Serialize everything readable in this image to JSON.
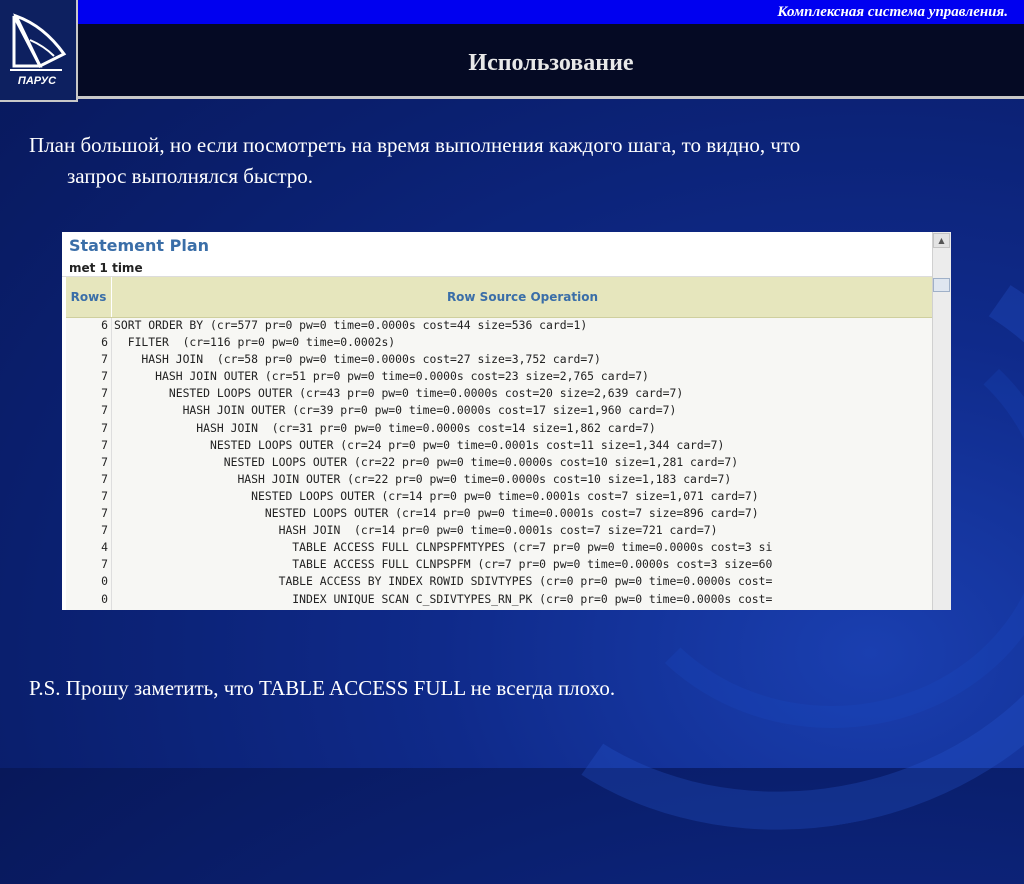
{
  "header": {
    "brand_line": "Комплексная система управления.",
    "title": "Использование",
    "logo_text": "ПАРУС"
  },
  "body": {
    "paragraph_line1": "План большой, но если посмотреть на время выполнения каждого шага, то видно, что",
    "paragraph_line2": "запрос выполнялся быстро.",
    "ps": "P.S. Прошу заметить, что TABLE ACCESS FULL не всегда плохо."
  },
  "plan": {
    "title": "Statement Plan",
    "subtitle": "met 1 time",
    "columns": {
      "rows": "Rows",
      "operation": "Row Source Operation"
    },
    "rows": [
      {
        "count": "6",
        "op": "SORT ORDER BY (cr=577 pr=0 pw=0 time=0.0000s cost=44 size=536 card=1)"
      },
      {
        "count": "6",
        "op": "  FILTER  (cr=116 pr=0 pw=0 time=0.0002s)"
      },
      {
        "count": "7",
        "op": "    HASH JOIN  (cr=58 pr=0 pw=0 time=0.0000s cost=27 size=3,752 card=7)"
      },
      {
        "count": "7",
        "op": "      HASH JOIN OUTER (cr=51 pr=0 pw=0 time=0.0000s cost=23 size=2,765 card=7)"
      },
      {
        "count": "7",
        "op": "        NESTED LOOPS OUTER (cr=43 pr=0 pw=0 time=0.0000s cost=20 size=2,639 card=7)"
      },
      {
        "count": "7",
        "op": "          HASH JOIN OUTER (cr=39 pr=0 pw=0 time=0.0000s cost=17 size=1,960 card=7)"
      },
      {
        "count": "7",
        "op": "            HASH JOIN  (cr=31 pr=0 pw=0 time=0.0000s cost=14 size=1,862 card=7)"
      },
      {
        "count": "7",
        "op": "              NESTED LOOPS OUTER (cr=24 pr=0 pw=0 time=0.0001s cost=11 size=1,344 card=7)"
      },
      {
        "count": "7",
        "op": "                NESTED LOOPS OUTER (cr=22 pr=0 pw=0 time=0.0000s cost=10 size=1,281 card=7)"
      },
      {
        "count": "7",
        "op": "                  HASH JOIN OUTER (cr=22 pr=0 pw=0 time=0.0000s cost=10 size=1,183 card=7)"
      },
      {
        "count": "7",
        "op": "                    NESTED LOOPS OUTER (cr=14 pr=0 pw=0 time=0.0001s cost=7 size=1,071 card=7)"
      },
      {
        "count": "7",
        "op": "                      NESTED LOOPS OUTER (cr=14 pr=0 pw=0 time=0.0001s cost=7 size=896 card=7)"
      },
      {
        "count": "7",
        "op": "                        HASH JOIN  (cr=14 pr=0 pw=0 time=0.0001s cost=7 size=721 card=7)"
      },
      {
        "count": "4",
        "op": "                          TABLE ACCESS FULL CLNPSPFMTYPES (cr=7 pr=0 pw=0 time=0.0000s cost=3 si"
      },
      {
        "count": "7",
        "op": "                          TABLE ACCESS FULL CLNPSPFM (cr=7 pr=0 pw=0 time=0.0000s cost=3 size=60"
      },
      {
        "count": "0",
        "op": "                        TABLE ACCESS BY INDEX ROWID SDIVTYPES (cr=0 pr=0 pw=0 time=0.0000s cost="
      },
      {
        "count": "0",
        "op": "                          INDEX UNIQUE SCAN C_SDIVTYPES_RN_PK (cr=0 pr=0 pw=0 time=0.0000s cost="
      }
    ]
  },
  "colors": {
    "top_bar": "#0000f0",
    "title_bar": "#050a24",
    "background": "#0f2a8a",
    "plan_title": "#3a6ea8",
    "plan_header_bg": "#e6e6bd"
  }
}
